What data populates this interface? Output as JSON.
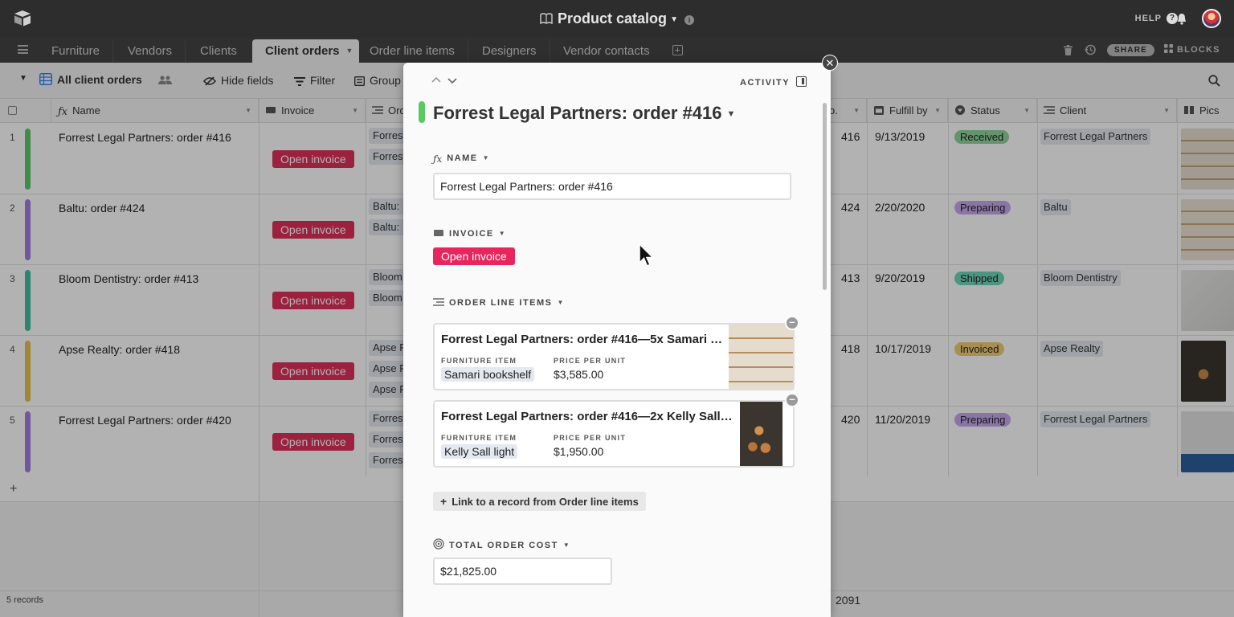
{
  "app": {
    "title": "Product catalog",
    "help": "HELP",
    "share": "SHARE",
    "blocks": "BLOCKS"
  },
  "tabs": [
    "Furniture",
    "Vendors",
    "Clients",
    "Client orders",
    "Order line items",
    "Designers",
    "Vendor contacts"
  ],
  "active_tab_index": 3,
  "toolbar": {
    "view_name": "All client orders",
    "hide_fields": "Hide fields",
    "filter": "Filter",
    "group": "Group"
  },
  "columns": {
    "name": "Name",
    "invoice": "Invoice",
    "order_partial": "Ord",
    "no_partial": "o.",
    "fulfill_by": "Fulfill by",
    "status": "Status",
    "client": "Client",
    "pics": "Pics"
  },
  "rows": [
    {
      "n": "1",
      "name": "Forrest Legal Partners: order #416",
      "invoice": "Open invoice",
      "links": [
        "Forrest",
        "Forrest"
      ],
      "no": "416",
      "date": "9/13/2019",
      "status": "Received",
      "client": "Forrest Legal Partners"
    },
    {
      "n": "2",
      "name": "Baltu: order #424",
      "invoice": "Open invoice",
      "links": [
        "Baltu:",
        "Baltu:"
      ],
      "no": "424",
      "date": "2/20/2020",
      "status": "Preparing",
      "client": "Baltu"
    },
    {
      "n": "3",
      "name": "Bloom Dentistry: order #413",
      "invoice": "Open invoice",
      "links": [
        "Bloom",
        "Bloom"
      ],
      "no": "413",
      "date": "9/20/2019",
      "status": "Shipped",
      "client": "Bloom Dentistry"
    },
    {
      "n": "4",
      "name": "Apse Realty: order #418",
      "invoice": "Open invoice",
      "links": [
        "Apse R",
        "Apse R",
        "Apse R"
      ],
      "no": "418",
      "date": "10/17/2019",
      "status": "Invoiced",
      "client": "Apse Realty"
    },
    {
      "n": "5",
      "name": "Forrest Legal Partners: order #420",
      "invoice": "Open invoice",
      "links": [
        "Forrest",
        "Forrest",
        "Forrest"
      ],
      "no": "420",
      "date": "11/20/2019",
      "status": "Preparing",
      "client": "Forrest Legal Partners"
    }
  ],
  "colors": {
    "row_bars": [
      "#59c965",
      "#a37ee0",
      "#3fc0a0",
      "#e8c14a",
      "#a37ee0"
    ],
    "status": {
      "Received": "#8ed49b",
      "Preparing": "#c8a8f0",
      "Shipped": "#6fd6b8",
      "Invoiced": "#f0cf72"
    },
    "invoice_button": "#e0305a"
  },
  "footer": {
    "records": "5 records",
    "sum_partial": "2091"
  },
  "modal": {
    "title": "Forrest Legal Partners: order #416",
    "activity": "ACTIVITY",
    "name_label": "NAME",
    "name_value": "Forrest Legal Partners: order #416",
    "invoice_label": "INVOICE",
    "invoice_button": "Open invoice",
    "order_items_label": "ORDER LINE ITEMS",
    "cards": [
      {
        "title": "Forrest Legal Partners: order #416—5x Samari bo...",
        "item_label": "FURNITURE ITEM",
        "item": "Samari bookshelf",
        "price_label": "PRICE PER UNIT",
        "price": "$3,585.00"
      },
      {
        "title": "Forrest Legal Partners: order #416—2x Kelly Sall l...",
        "item_label": "FURNITURE ITEM",
        "item": "Kelly Sall light",
        "price_label": "PRICE PER UNIT",
        "price": "$1,950.00"
      }
    ],
    "link_record": "Link to a record from Order line items",
    "total_label": "TOTAL ORDER COST",
    "total_value": "$21,825.00"
  },
  "icons": {
    "logo": "airtable-logo-icon",
    "menu": "menu-icon",
    "bell": "bell-icon",
    "search": "search-icon",
    "close": "close-icon"
  }
}
